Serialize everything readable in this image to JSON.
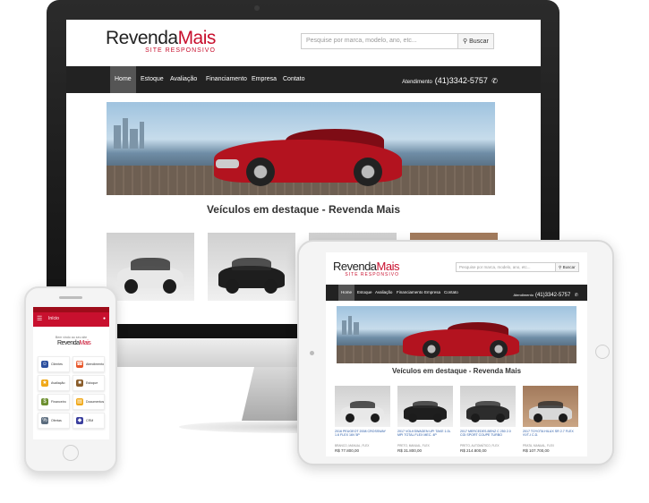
{
  "brand": {
    "name_part1": "Revenda",
    "name_part2": "Mais",
    "tagline": "SITE RESPONSIVO"
  },
  "search": {
    "placeholder": "Pesquise por marca, modelo, ano, etc...",
    "button_label": "Buscar"
  },
  "nav": {
    "items": [
      "Home",
      "Estoque",
      "Avaliação",
      "Financiamento",
      "Empresa",
      "Contato"
    ],
    "active": "Home"
  },
  "contact": {
    "label": "Atendimento",
    "phone": "(41)3342-5757"
  },
  "featured": {
    "title": "Veículos em destaque - Revenda Mais"
  },
  "vehicles": [
    {
      "desc": "2016 PEUGEOT 2008 CROSSWAY 1.6 FLEX 16V 5P",
      "meta": "BRANCO, MANUAL, FLEX",
      "price": "R$ 77.800,00"
    },
    {
      "desc": "2017 VOLKSWAGEN UP! TAKE 1.0L MPI TOTAL FLEX MEC. 4P",
      "meta": "PRETO, MANUAL, FLEX",
      "price": "R$ 31.800,00"
    },
    {
      "desc": "2017 MERCEDES-BENZ C 250 2.0 CGI SPORT COUPE TURBO",
      "meta": "PRETO, AUTOMÁTICO, FLEX",
      "price": "R$ 214.800,00"
    },
    {
      "desc": "2017 TOYOTA HILUX SR 2.7 FLEX VVT-I C.D.",
      "meta": "PRATA, MANUAL, FLEX",
      "price": "R$ 107.700,00"
    }
  ],
  "mobile": {
    "title": "Início",
    "welcome": "Bem vindo ao seu site",
    "tiles": [
      "Clientes",
      "Atendimento",
      "Avaliação",
      "Estoque",
      "Financeiro",
      "Documentos",
      "Ofertas",
      "CRM"
    ],
    "tile_colors": [
      "#2b4f9e",
      "#e8562a",
      "#f0a818",
      "#8a5d2b",
      "#6c8f2f",
      "#f0a818",
      "#5a6b7d",
      "#3b3f9e"
    ]
  },
  "theme": {
    "accent": "#c8102e",
    "nav_bg": "#222222",
    "nav_active_bg": "#555555",
    "link": "#2457a5"
  }
}
